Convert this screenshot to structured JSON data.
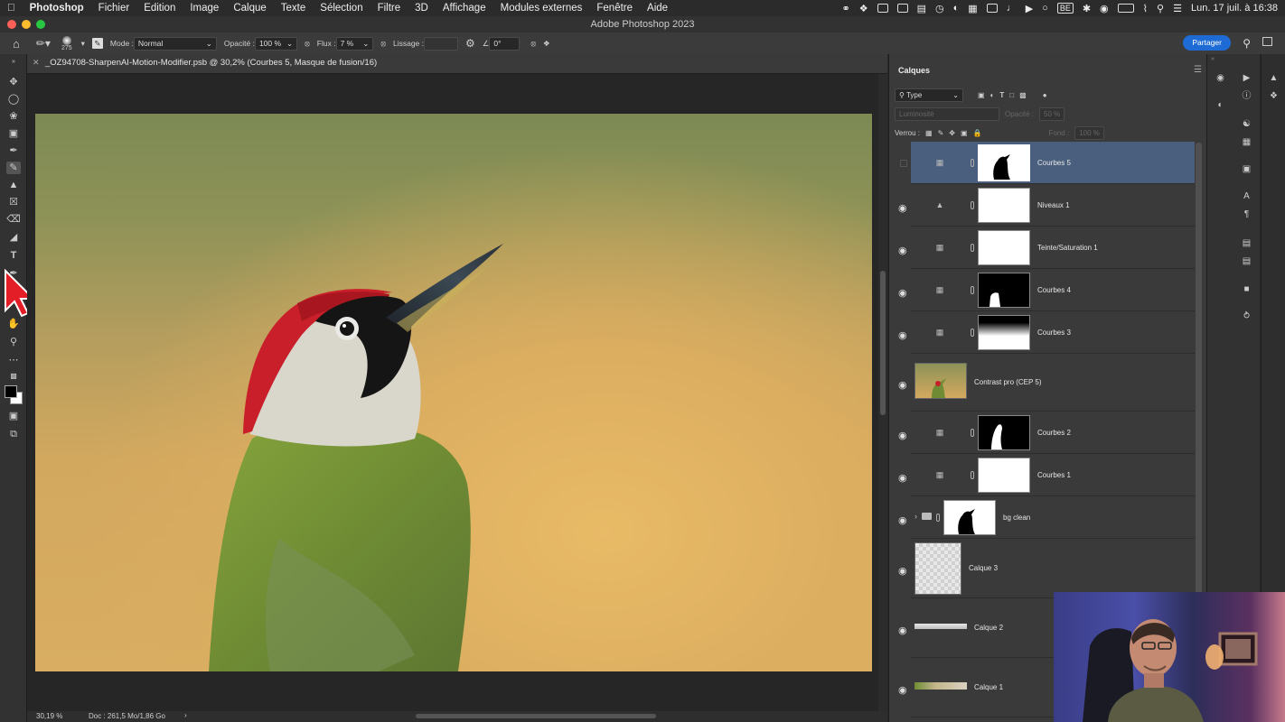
{
  "menubar": {
    "items": [
      "Photoshop",
      "Fichier",
      "Edition",
      "Image",
      "Calque",
      "Texte",
      "Sélection",
      "Filtre",
      "3D",
      "Affichage",
      "Modules externes",
      "Fenêtre",
      "Aide"
    ],
    "keyboard_layout": "BE",
    "datetime": "Lun. 17 juil. à 16:38"
  },
  "window": {
    "title": "Adobe Photoshop 2023"
  },
  "options": {
    "brush_size": "275",
    "mode_label": "Mode :",
    "mode_value": "Normal",
    "opacity_label": "Opacité :",
    "opacity_value": "100 %",
    "flow_label": "Flux :",
    "flow_value": "7 %",
    "smoothing_label": "Lissage :",
    "angle_value": "0°",
    "share_label": "Partager"
  },
  "document": {
    "tab_title": "_OZ94708-SharpenAI-Motion-Modifier.psb @ 30,2% (Courbes 5, Masque de fusion/16)",
    "zoom": "30,19 %",
    "doc_info": "Doc : 261,5 Mo/1,86 Go"
  },
  "layers_panel": {
    "tab_label": "Calques",
    "filter_value": "Type",
    "blend_mode": "Luminosité",
    "opacity_label": "Opacité :",
    "opacity_value": "50 %",
    "lock_label": "Verrou :",
    "fill_label": "Fond :",
    "fill_value": "100 %",
    "layers": [
      {
        "name": "Courbes 5",
        "selected": true
      },
      {
        "name": "Niveaux 1"
      },
      {
        "name": "Teinte/Saturation 1"
      },
      {
        "name": "Courbes 4"
      },
      {
        "name": "Courbes 3"
      },
      {
        "name": "Contrast pro (CEP 5)"
      },
      {
        "name": "Courbes 2"
      },
      {
        "name": "Courbes 1"
      },
      {
        "name": "bg clean"
      },
      {
        "name": "Calque 3"
      },
      {
        "name": "Calque 2"
      },
      {
        "name": "Calque 1"
      }
    ]
  },
  "colors": {
    "accent": "#1e6bd6",
    "selected_layer": "#4a5f7d",
    "woodpecker_red": "#c81f2a",
    "woodpecker_green": "#7e9a36"
  }
}
